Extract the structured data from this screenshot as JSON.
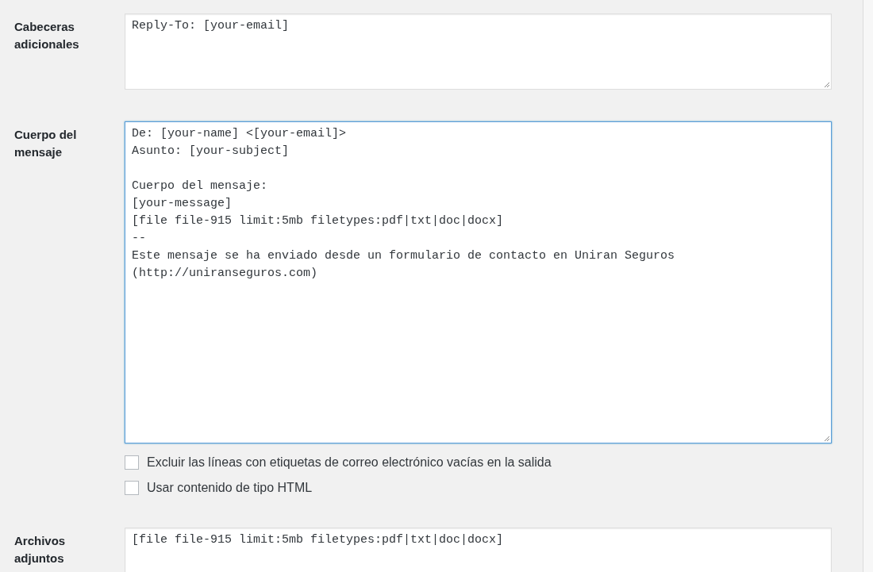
{
  "fields": [
    {
      "label": "Cabeceras adicionales",
      "value": "Reply-To: [your-email]",
      "focused": false
    },
    {
      "label": "Cuerpo del mensaje",
      "value": "De: [your-name] <[your-email]>\nAsunto: [your-subject]\n\nCuerpo del mensaje:\n[your-message]\n[file file-915 limit:5mb filetypes:pdf|txt|doc|docx]\n--\nEste mensaje se ha enviado desde un formulario de contacto en Uniran Seguros\n(http://uniranseguros.com)",
      "focused": true,
      "options": [
        {
          "label": "Excluir las líneas con etiquetas de correo electrónico vacías en la salida",
          "checked": false
        },
        {
          "label": "Usar contenido de tipo HTML",
          "checked": false
        }
      ]
    },
    {
      "label": "Archivos adjuntos",
      "value": "[file file-915 limit:5mb filetypes:pdf|txt|doc|docx]",
      "focused": false
    }
  ]
}
